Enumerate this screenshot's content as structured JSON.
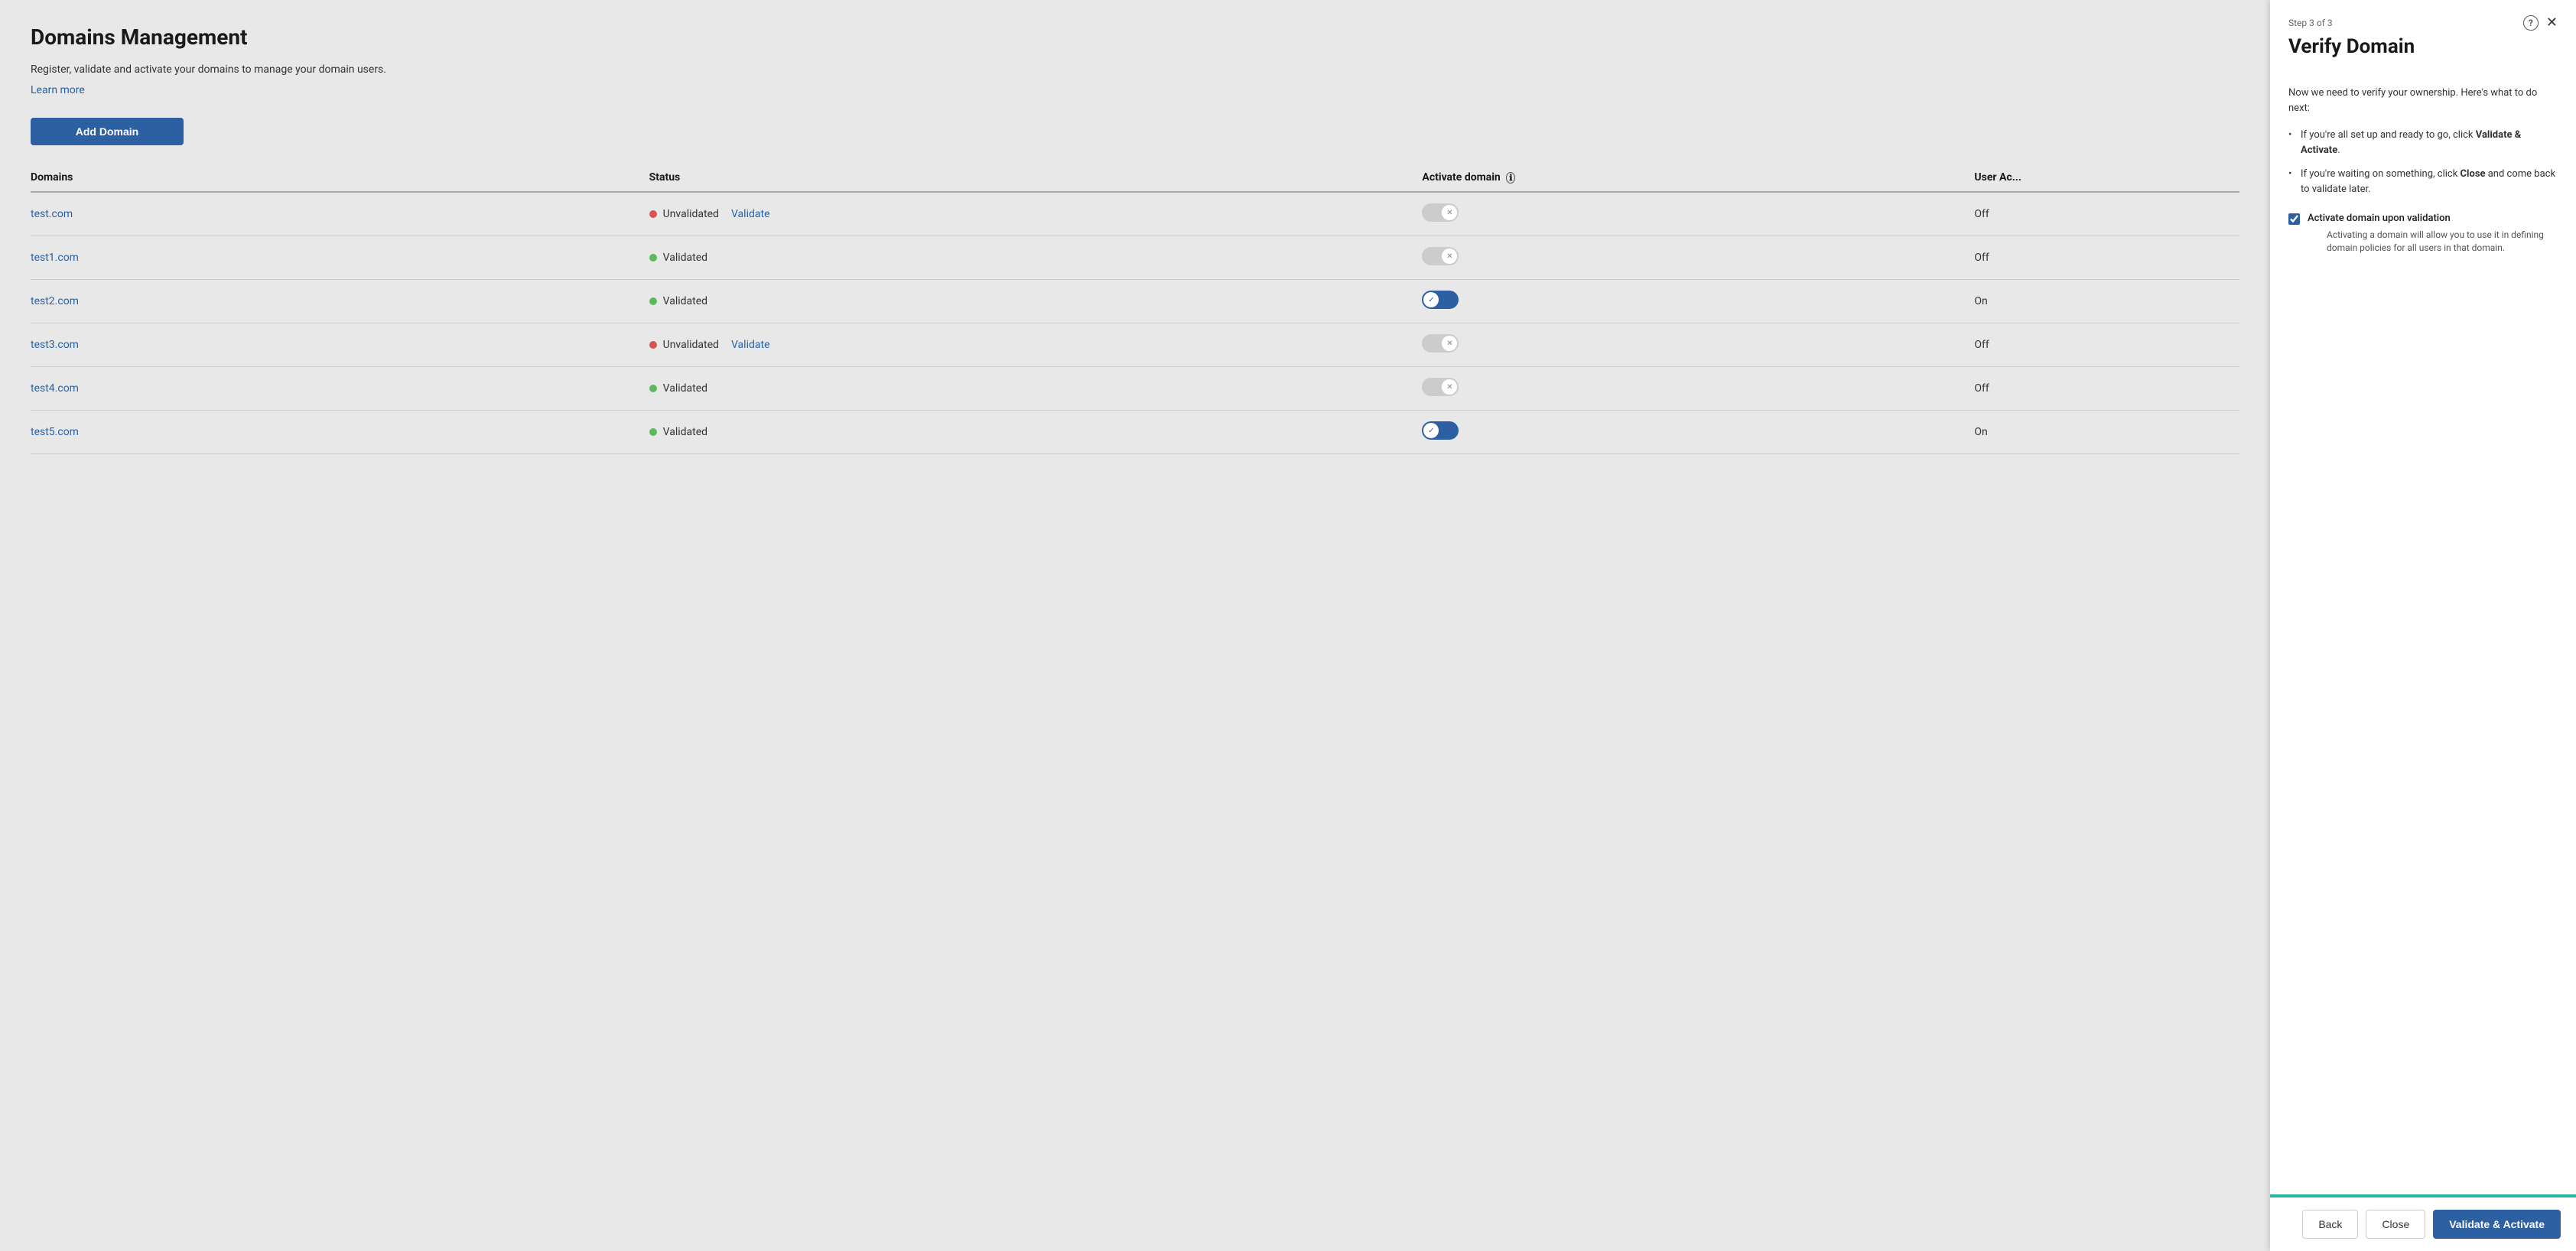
{
  "page": {
    "title": "Domains Management",
    "description": "Register, validate and activate your domains to manage your domain users.",
    "learn_more_label": "Learn more",
    "add_domain_label": "Add Domain"
  },
  "table": {
    "headers": {
      "domains": "Domains",
      "status": "Status",
      "activate_domain": "Activate domain",
      "user_accounts": "User Ac..."
    },
    "rows": [
      {
        "domain": "test.com",
        "status": "Unvalidated",
        "status_type": "red",
        "has_validate_link": true,
        "toggle_state": "off",
        "user_accounts": "Off"
      },
      {
        "domain": "test1.com",
        "status": "Validated",
        "status_type": "green",
        "has_validate_link": false,
        "toggle_state": "off",
        "user_accounts": "Off"
      },
      {
        "domain": "test2.com",
        "status": "Validated",
        "status_type": "green",
        "has_validate_link": false,
        "toggle_state": "on",
        "user_accounts": "On"
      },
      {
        "domain": "test3.com",
        "status": "Unvalidated",
        "status_type": "red",
        "has_validate_link": true,
        "toggle_state": "off",
        "user_accounts": "Off"
      },
      {
        "domain": "test4.com",
        "status": "Validated",
        "status_type": "green",
        "has_validate_link": false,
        "toggle_state": "off",
        "user_accounts": "Off"
      },
      {
        "domain": "test5.com",
        "status": "Validated",
        "status_type": "green",
        "has_validate_link": false,
        "toggle_state": "on",
        "user_accounts": "On"
      }
    ]
  },
  "panel": {
    "step_label": "Step 3 of 3",
    "title": "Verify Domain",
    "intro_text": "Now we need to verify your ownership. Here's what to do next:",
    "instructions": [
      {
        "text_before": "If you're all set up and ready to go, click ",
        "bold_text": "Validate & Activate",
        "text_after": "."
      },
      {
        "text_before": "If you're waiting on something, click ",
        "bold_text": "Close",
        "text_after": " and come back to validate later."
      }
    ],
    "checkbox_label": "Activate domain upon validation",
    "checkbox_description": "Activating a domain will allow you to use it in defining domain policies for all users in that domain.",
    "checkbox_checked": true
  },
  "footer": {
    "back_label": "Back",
    "close_label": "Close",
    "validate_label": "Validate & Activate"
  }
}
